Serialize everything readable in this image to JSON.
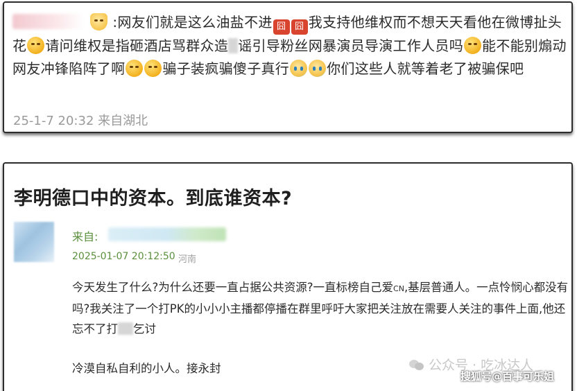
{
  "comment": {
    "segments": [
      ":网友们就是这么油盐不进",
      "我支持他维权而不想天天看他在微博扯头花",
      "请问维权是指砸酒店骂群众造",
      "谣引导粉丝网暴演员导演工作人员吗",
      "能不能别煽动网友冲锋陷阵了啊",
      "骗子装疯骗傻子真行",
      "你们这些人就等着老了被骗保吧"
    ],
    "tag_glyph": "囧",
    "meta": "25-1-7 20:32 来自湖北"
  },
  "post": {
    "title": "李明德口中的资本。到底谁资本?",
    "from_label": "来自:",
    "date": "2025-01-07 20:12:50",
    "location": "河南",
    "body_part1": "今天发生了什么?为什么还要一直占据公共资源?一直标榜自己爱",
    "body_cn": "CN",
    "body_part2": ",基层普通人。一点怜悯心都没有吗?我关注了一个打PK的小小小主播都停播在群里呼吁大家把关注放在需要人关注的事件上面,他还忘不了打",
    "body_part3": "乞讨",
    "tail": "冷漠自私自利的小人。接永封"
  },
  "watermarks": {
    "wechat": "公众号 · 吃冰达人",
    "sohu": "搜狐号@百事可乐姐"
  }
}
